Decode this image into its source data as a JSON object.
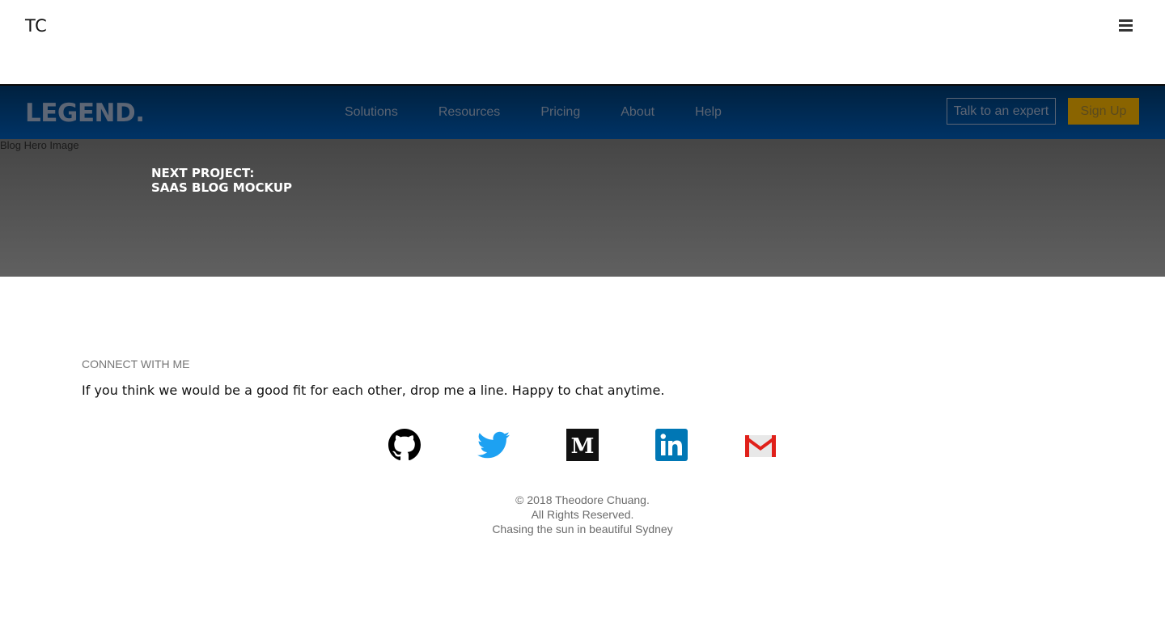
{
  "header": {
    "brand": "TC",
    "menu_icon": "hamburger-menu-icon"
  },
  "hero": {
    "mock_nav": {
      "logo": "LEGEND.",
      "links": [
        "Solutions",
        "Resources",
        "Pricing",
        "About",
        "Help"
      ],
      "expert_button": "Talk to an expert",
      "signup_button": "Sign Up"
    },
    "image_alt": "Blog Hero Image",
    "title_line1": "NEXT PROJECT:",
    "title_line2": "SAAS BLOG MOCKUP"
  },
  "connect": {
    "heading": "CONNECT WITH ME",
    "text": "If you think we would be a good fit for each other, drop me a line. Happy to chat anytime."
  },
  "socials": [
    {
      "icon": "github-icon",
      "color": "#000000"
    },
    {
      "icon": "twitter-icon",
      "color": "#1da1f2"
    },
    {
      "icon": "medium-icon",
      "color": "#111111"
    },
    {
      "icon": "linkedin-icon",
      "color": "#0077b5"
    },
    {
      "icon": "gmail-icon",
      "color": "#e0201a"
    }
  ],
  "footer": {
    "line1": "© 2018 Theodore Chuang.",
    "line2": "All Rights Reserved.",
    "line3": "Chasing the sun in beautiful Sydney"
  }
}
